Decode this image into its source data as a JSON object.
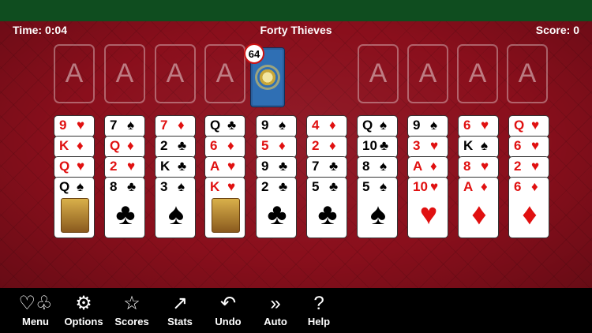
{
  "hud": {
    "time_label": "Time: 0:04",
    "title": "Forty Thieves",
    "score_label": "Score: 0"
  },
  "foundations": [
    "A",
    "A",
    "A",
    "A",
    "A",
    "A",
    "A",
    "A"
  ],
  "stock": {
    "count": "64"
  },
  "columns": [
    [
      {
        "r": "9",
        "s": "♥",
        "c": "red"
      },
      {
        "r": "K",
        "s": "♦",
        "c": "red"
      },
      {
        "r": "Q",
        "s": "♥",
        "c": "red"
      },
      {
        "r": "Q",
        "s": "♠",
        "c": "black",
        "face": true
      }
    ],
    [
      {
        "r": "7",
        "s": "♠",
        "c": "black"
      },
      {
        "r": "Q",
        "s": "♦",
        "c": "red"
      },
      {
        "r": "2",
        "s": "♥",
        "c": "red"
      },
      {
        "r": "8",
        "s": "♣",
        "c": "black"
      }
    ],
    [
      {
        "r": "7",
        "s": "♦",
        "c": "red"
      },
      {
        "r": "2",
        "s": "♣",
        "c": "black"
      },
      {
        "r": "K",
        "s": "♣",
        "c": "black"
      },
      {
        "r": "3",
        "s": "♠",
        "c": "black"
      }
    ],
    [
      {
        "r": "Q",
        "s": "♣",
        "c": "black"
      },
      {
        "r": "6",
        "s": "♦",
        "c": "red"
      },
      {
        "r": "A",
        "s": "♥",
        "c": "red"
      },
      {
        "r": "K",
        "s": "♥",
        "c": "red",
        "face": true
      }
    ],
    [
      {
        "r": "9",
        "s": "♠",
        "c": "black"
      },
      {
        "r": "5",
        "s": "♦",
        "c": "red"
      },
      {
        "r": "9",
        "s": "♣",
        "c": "black"
      },
      {
        "r": "2",
        "s": "♣",
        "c": "black"
      }
    ],
    [
      {
        "r": "4",
        "s": "♦",
        "c": "red"
      },
      {
        "r": "2",
        "s": "♦",
        "c": "red"
      },
      {
        "r": "7",
        "s": "♣",
        "c": "black"
      },
      {
        "r": "5",
        "s": "♣",
        "c": "black"
      }
    ],
    [
      {
        "r": "Q",
        "s": "♠",
        "c": "black"
      },
      {
        "r": "10",
        "s": "♣",
        "c": "black"
      },
      {
        "r": "8",
        "s": "♠",
        "c": "black"
      },
      {
        "r": "5",
        "s": "♠",
        "c": "black"
      }
    ],
    [
      {
        "r": "9",
        "s": "♠",
        "c": "black"
      },
      {
        "r": "3",
        "s": "♥",
        "c": "red"
      },
      {
        "r": "A",
        "s": "♦",
        "c": "red"
      },
      {
        "r": "10",
        "s": "♥",
        "c": "red"
      }
    ],
    [
      {
        "r": "6",
        "s": "♥",
        "c": "red"
      },
      {
        "r": "K",
        "s": "♠",
        "c": "black"
      },
      {
        "r": "8",
        "s": "♥",
        "c": "red"
      },
      {
        "r": "A",
        "s": "♦",
        "c": "red"
      }
    ],
    [
      {
        "r": "Q",
        "s": "♥",
        "c": "red"
      },
      {
        "r": "6",
        "s": "♥",
        "c": "red"
      },
      {
        "r": "2",
        "s": "♥",
        "c": "red"
      },
      {
        "r": "6",
        "s": "♦",
        "c": "red"
      }
    ]
  ],
  "toolbar": [
    {
      "label": "Menu",
      "icon": "♡♧"
    },
    {
      "label": "Options",
      "icon": "⚙"
    },
    {
      "label": "Scores",
      "icon": "☆"
    },
    {
      "label": "Stats",
      "icon": "↗"
    },
    {
      "label": "Undo",
      "icon": "↶"
    },
    {
      "label": "Auto",
      "icon": "»"
    },
    {
      "label": "Help",
      "icon": "?"
    }
  ]
}
